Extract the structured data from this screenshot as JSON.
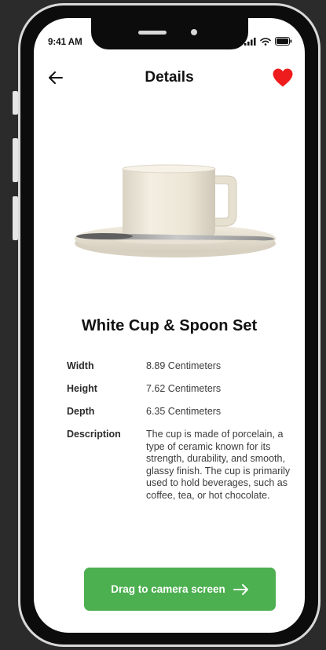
{
  "status_bar": {
    "time": "9:41 AM",
    "icons": [
      "signal-icon",
      "wifi-icon",
      "battery-icon"
    ]
  },
  "header": {
    "title": "Details",
    "back_icon": "arrow-left-icon",
    "favorite_icon": "heart-icon",
    "favorite_color": "#ee1c1c"
  },
  "product": {
    "name": "White Cup & Spoon Set",
    "image": "cup-and-spoon-image",
    "specs": [
      {
        "label": "Width",
        "value": "8.89 Centimeters"
      },
      {
        "label": "Height",
        "value": "7.62 Centimeters"
      },
      {
        "label": "Depth",
        "value": "6.35 Centimeters"
      },
      {
        "label": "Description",
        "value": "The cup is made of porcelain, a type of ceramic known for its strength, durability, and smooth, glassy finish. The cup is primarily used to hold beverages, such as coffee, tea, or hot chocolate."
      }
    ]
  },
  "cta": {
    "label": "Drag to camera screen",
    "icon": "arrow-right-icon",
    "color": "#4caf50"
  }
}
